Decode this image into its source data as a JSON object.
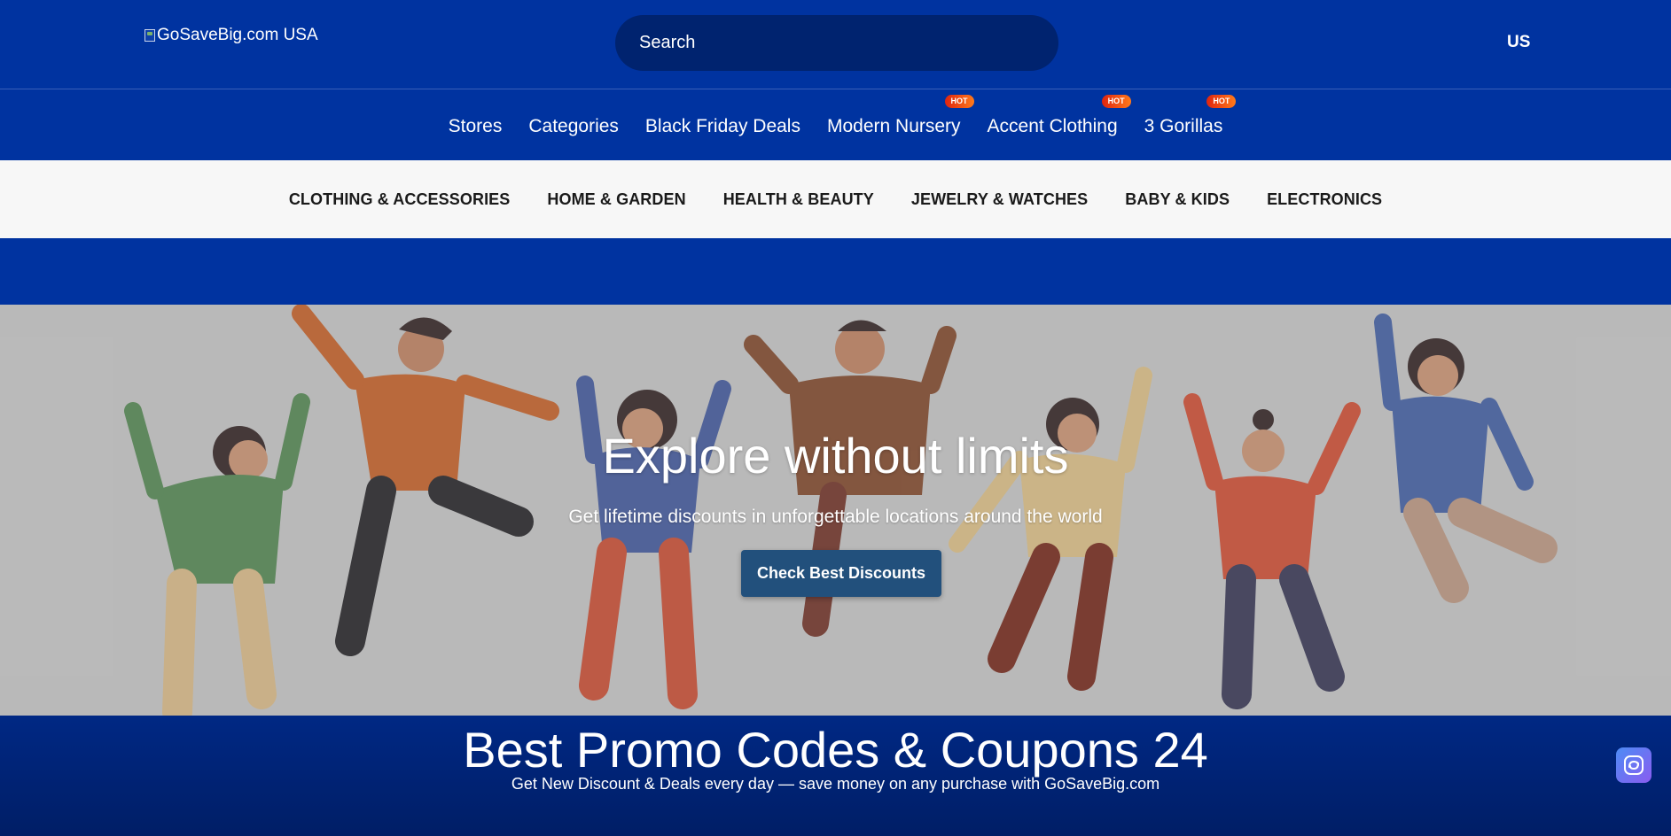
{
  "header": {
    "logo_alt": "GoSaveBig.com USA",
    "search_placeholder": "Search",
    "country": "US"
  },
  "nav": {
    "items": [
      {
        "label": "Stores",
        "badge": ""
      },
      {
        "label": "Categories",
        "badge": ""
      },
      {
        "label": "Black Friday Deals",
        "badge": ""
      },
      {
        "label": "Modern Nursery",
        "badge": "HOT"
      },
      {
        "label": "Accent Clothing",
        "badge": "HOT"
      },
      {
        "label": "3 Gorillas",
        "badge": "HOT"
      }
    ]
  },
  "categories": [
    "CLOTHING & ACCESSORIES",
    "HOME & GARDEN",
    "HEALTH & BEAUTY",
    "JEWELRY & WATCHES",
    "BABY & KIDS",
    "ELECTRONICS"
  ],
  "hero": {
    "title": "Explore without limits",
    "subtitle": "Get lifetime discounts in unforgettable locations around the world",
    "button": "Check Best Discounts"
  },
  "promo": {
    "title": "Best Promo Codes & Coupons 24",
    "subtitle": "Get New Discount & Deals every day — save money on any purchase with GoSaveBig.com"
  },
  "colors": {
    "brand_blue": "#0033a0",
    "search_bg": "#00236f",
    "hero_button": "#22507c",
    "hot_badge": "#e0240f"
  },
  "icons": {
    "assistant": "assistant-icon",
    "logo": "broken-image-icon"
  }
}
